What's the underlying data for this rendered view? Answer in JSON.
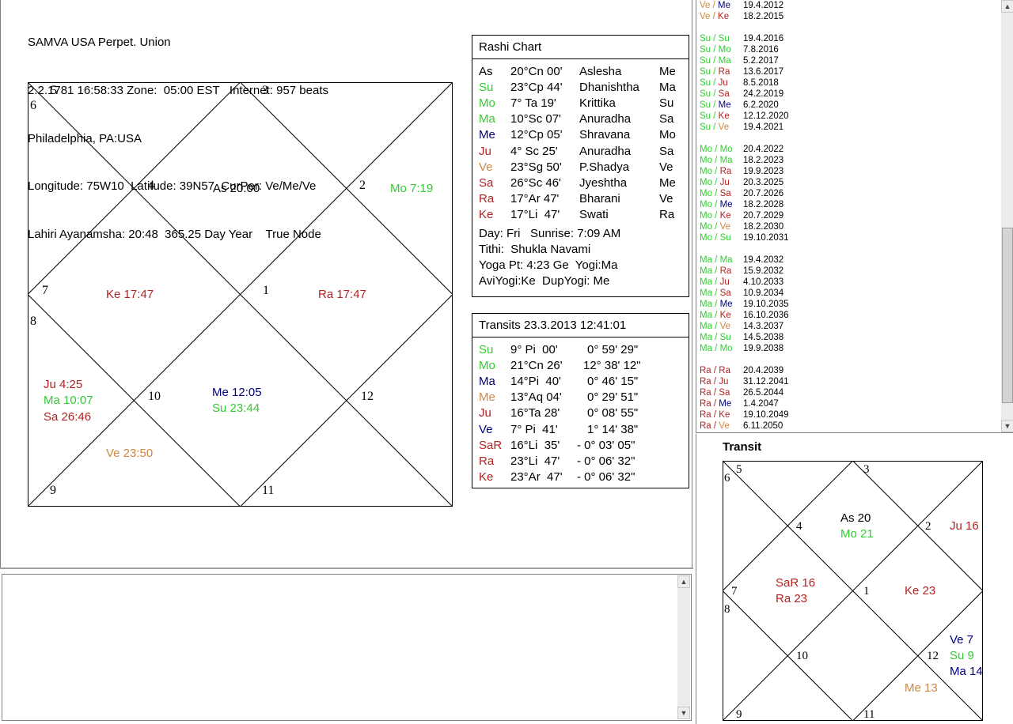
{
  "header": {
    "line1": "SAMVA USA Perpet. Union",
    "line2": "2.2.1781 16:58:33 Zone:  05:00 EST   Internet: 957 beats",
    "line3": "Philadelphia, PA:USA",
    "line4": "Longitude: 75W10  Latitude: 39N57  CurPer: Ve/Me/Ve",
    "line5": "Lahiri Ayanamsha: 20:48  365.25 Day Year    True Node"
  },
  "colors": {
    "green": "#33cc33",
    "red": "#b22222",
    "blue": "#000080",
    "orange": "#cc8844",
    "black": "#000000"
  },
  "main_chart": {
    "house_numbers": [
      "1",
      "2",
      "3",
      "4",
      "5",
      "6",
      "7",
      "8",
      "9",
      "10",
      "11",
      "12"
    ],
    "planets": {
      "asc": "As 20:00",
      "moon": "Mo 7:19",
      "ketu": "Ke 17:47",
      "rahu": "Ra 17:47",
      "jupiter": "Ju 4:25",
      "mars": "Ma 10:07",
      "saturn": "Sa 26:46",
      "mercury": "Me 12:05",
      "sun": "Su 23:44",
      "venus": "Ve 23:50"
    }
  },
  "rashi": {
    "title": "Rashi Chart",
    "rows": [
      {
        "p": "As",
        "deg": "20°Cn 00'",
        "nak": "Aslesha",
        "lord": "Me",
        "color": "#000000"
      },
      {
        "p": "Su",
        "deg": "23°Cp 44'",
        "nak": "Dhanishtha",
        "lord": "Ma",
        "color": "#33cc33"
      },
      {
        "p": "Mo",
        "deg": "7° Ta 19'",
        "nak": "Krittika",
        "lord": "Su",
        "color": "#33cc33"
      },
      {
        "p": "Ma",
        "deg": "10°Sc 07'",
        "nak": "Anuradha",
        "lord": "Sa",
        "color": "#33cc33"
      },
      {
        "p": "Me",
        "deg": "12°Cp 05'",
        "nak": "Shravana",
        "lord": "Mo",
        "color": "#000080"
      },
      {
        "p": "Ju",
        "deg": "4° Sc 25'",
        "nak": "Anuradha",
        "lord": "Sa",
        "color": "#b22222"
      },
      {
        "p": "Ve",
        "deg": "23°Sg 50'",
        "nak": "P.Shadya",
        "lord": "Ve",
        "color": "#cc8844"
      },
      {
        "p": "Sa",
        "deg": "26°Sc 46'",
        "nak": "Jyeshtha",
        "lord": "Me",
        "color": "#b22222"
      },
      {
        "p": "Ra",
        "deg": "17°Ar 47'",
        "nak": "Bharani",
        "lord": "Ve",
        "color": "#b22222"
      },
      {
        "p": "Ke",
        "deg": "17°Li  47'",
        "nak": "Swati",
        "lord": "Ra",
        "color": "#b22222"
      }
    ],
    "day": "Day: Fri   Sunrise: 7:09 AM",
    "tithi": "Tithi:  Shukla Navami",
    "yoga": "Yoga Pt: 4:23 Ge  Yogi:Ma",
    "avi": "AviYogi:Ke  DupYogi: Me"
  },
  "transits": {
    "title": "Transits 23.3.2013 12:41:01",
    "rows": [
      {
        "p": "Su",
        "deg": "9° Pi  00'",
        "speed": "0° 59' 29\"",
        "color": "#33cc33"
      },
      {
        "p": "Mo",
        "deg": "21°Cn 26'",
        "speed": "12° 38' 12\"",
        "color": "#33cc33"
      },
      {
        "p": "Ma",
        "deg": "14°Pi  40'",
        "speed": "0° 46' 15\"",
        "color": "#000080"
      },
      {
        "p": "Me",
        "deg": "13°Aq 04'",
        "speed": "0° 29' 51\"",
        "color": "#cc8844"
      },
      {
        "p": "Ju",
        "deg": "16°Ta 28'",
        "speed": "0° 08' 55\"",
        "color": "#b22222"
      },
      {
        "p": "Ve",
        "deg": "7° Pi  41'",
        "speed": "1° 14' 38\"",
        "color": "#000080"
      },
      {
        "p": "SaR",
        "deg": "16°Li  35'",
        "speed": "- 0° 03' 05\"",
        "color": "#b22222"
      },
      {
        "p": "Ra",
        "deg": "23°Li  47'",
        "speed": "- 0° 06' 32\"",
        "color": "#b22222"
      },
      {
        "p": "Ke",
        "deg": "23°Ar  47'",
        "speed": "- 0° 06' 32\"",
        "color": "#b22222"
      }
    ]
  },
  "dasha": {
    "groups": [
      [
        {
          "a": "Ve",
          "b": "Me",
          "date": "19.4.2012",
          "ca": "#cc8844",
          "cb": "#000080"
        },
        {
          "a": "Ve",
          "b": "Ke",
          "date": "18.2.2015",
          "ca": "#cc8844",
          "cb": "#b22222"
        }
      ],
      [
        {
          "a": "Su",
          "b": "Su",
          "date": "19.4.2016",
          "ca": "#33cc33",
          "cb": "#33cc33"
        },
        {
          "a": "Su",
          "b": "Mo",
          "date": "7.8.2016",
          "ca": "#33cc33",
          "cb": "#33cc33"
        },
        {
          "a": "Su",
          "b": "Ma",
          "date": "5.2.2017",
          "ca": "#33cc33",
          "cb": "#33cc33"
        },
        {
          "a": "Su",
          "b": "Ra",
          "date": "13.6.2017",
          "ca": "#33cc33",
          "cb": "#b22222"
        },
        {
          "a": "Su",
          "b": "Ju",
          "date": "8.5.2018",
          "ca": "#33cc33",
          "cb": "#b22222"
        },
        {
          "a": "Su",
          "b": "Sa",
          "date": "24.2.2019",
          "ca": "#33cc33",
          "cb": "#b22222"
        },
        {
          "a": "Su",
          "b": "Me",
          "date": "6.2.2020",
          "ca": "#33cc33",
          "cb": "#000080"
        },
        {
          "a": "Su",
          "b": "Ke",
          "date": "12.12.2020",
          "ca": "#33cc33",
          "cb": "#b22222"
        },
        {
          "a": "Su",
          "b": "Ve",
          "date": "19.4.2021",
          "ca": "#33cc33",
          "cb": "#cc8844"
        }
      ],
      [
        {
          "a": "Mo",
          "b": "Mo",
          "date": "20.4.2022",
          "ca": "#33cc33",
          "cb": "#33cc33"
        },
        {
          "a": "Mo",
          "b": "Ma",
          "date": "18.2.2023",
          "ca": "#33cc33",
          "cb": "#33cc33"
        },
        {
          "a": "Mo",
          "b": "Ra",
          "date": "19.9.2023",
          "ca": "#33cc33",
          "cb": "#b22222"
        },
        {
          "a": "Mo",
          "b": "Ju",
          "date": "20.3.2025",
          "ca": "#33cc33",
          "cb": "#b22222"
        },
        {
          "a": "Mo",
          "b": "Sa",
          "date": "20.7.2026",
          "ca": "#33cc33",
          "cb": "#b22222"
        },
        {
          "a": "Mo",
          "b": "Me",
          "date": "18.2.2028",
          "ca": "#33cc33",
          "cb": "#000080"
        },
        {
          "a": "Mo",
          "b": "Ke",
          "date": "20.7.2029",
          "ca": "#33cc33",
          "cb": "#b22222"
        },
        {
          "a": "Mo",
          "b": "Ve",
          "date": "18.2.2030",
          "ca": "#33cc33",
          "cb": "#cc8844"
        },
        {
          "a": "Mo",
          "b": "Su",
          "date": "19.10.2031",
          "ca": "#33cc33",
          "cb": "#33cc33"
        }
      ],
      [
        {
          "a": "Ma",
          "b": "Ma",
          "date": "19.4.2032",
          "ca": "#33cc33",
          "cb": "#33cc33"
        },
        {
          "a": "Ma",
          "b": "Ra",
          "date": "15.9.2032",
          "ca": "#33cc33",
          "cb": "#b22222"
        },
        {
          "a": "Ma",
          "b": "Ju",
          "date": "4.10.2033",
          "ca": "#33cc33",
          "cb": "#b22222"
        },
        {
          "a": "Ma",
          "b": "Sa",
          "date": "10.9.2034",
          "ca": "#33cc33",
          "cb": "#b22222"
        },
        {
          "a": "Ma",
          "b": "Me",
          "date": "19.10.2035",
          "ca": "#33cc33",
          "cb": "#000080"
        },
        {
          "a": "Ma",
          "b": "Ke",
          "date": "16.10.2036",
          "ca": "#33cc33",
          "cb": "#b22222"
        },
        {
          "a": "Ma",
          "b": "Ve",
          "date": "14.3.2037",
          "ca": "#33cc33",
          "cb": "#cc8844"
        },
        {
          "a": "Ma",
          "b": "Su",
          "date": "14.5.2038",
          "ca": "#33cc33",
          "cb": "#33cc33"
        },
        {
          "a": "Ma",
          "b": "Mo",
          "date": "19.9.2038",
          "ca": "#33cc33",
          "cb": "#33cc33"
        }
      ],
      [
        {
          "a": "Ra",
          "b": "Ra",
          "date": "20.4.2039",
          "ca": "#b22222",
          "cb": "#b22222"
        },
        {
          "a": "Ra",
          "b": "Ju",
          "date": "31.12.2041",
          "ca": "#b22222",
          "cb": "#b22222"
        },
        {
          "a": "Ra",
          "b": "Sa",
          "date": "26.5.2044",
          "ca": "#b22222",
          "cb": "#b22222"
        },
        {
          "a": "Ra",
          "b": "Me",
          "date": "1.4.2047",
          "ca": "#b22222",
          "cb": "#000080"
        },
        {
          "a": "Ra",
          "b": "Ke",
          "date": "19.10.2049",
          "ca": "#b22222",
          "cb": "#b22222"
        },
        {
          "a": "Ra",
          "b": "Ve",
          "date": "6.11.2050",
          "ca": "#b22222",
          "cb": "#cc8844"
        }
      ]
    ]
  },
  "transit_chart": {
    "title": "Transit",
    "house_numbers": [
      "1",
      "2",
      "3",
      "4",
      "5",
      "6",
      "7",
      "8",
      "9",
      "10",
      "11",
      "12"
    ],
    "planets": {
      "asc": "As 20",
      "moon": "Mo 21",
      "jupiter": "Ju 16",
      "saturn": "SaR 16",
      "rahu": "Ra 23",
      "ketu": "Ke 23",
      "venus": "Ve 7",
      "sun": "Su 9",
      "mars": "Ma 14",
      "mercury": "Me 13"
    }
  }
}
